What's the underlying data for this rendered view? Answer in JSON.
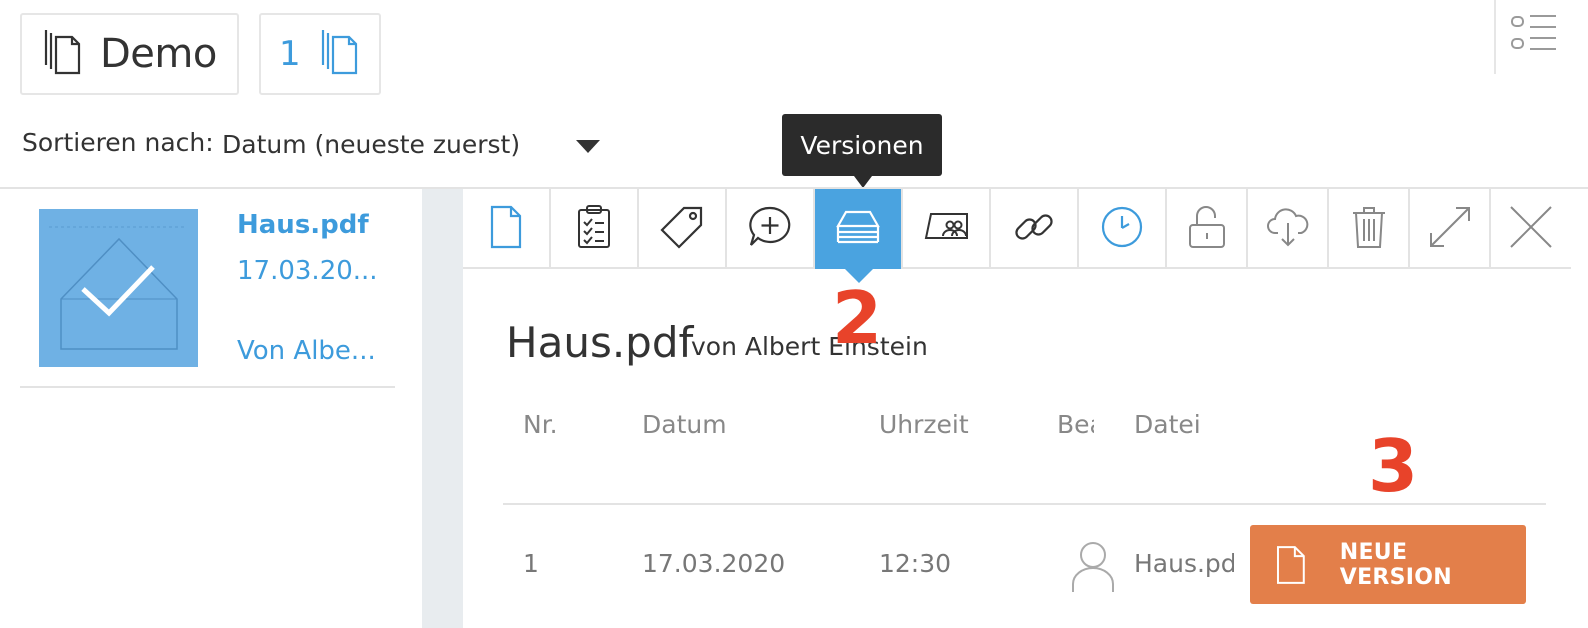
{
  "header": {
    "project_button_label": "Demo",
    "document_count_label": "1"
  },
  "sort": {
    "label": "Sortieren nach:",
    "value": "Datum (neueste zuerst)"
  },
  "tooltip": {
    "text": "Versionen"
  },
  "file_list": {
    "items": [
      {
        "name": "Haus.pdf",
        "date": "17.03.20...",
        "author": "Von Albe..."
      }
    ]
  },
  "toolbar": {
    "icons": [
      "document-icon",
      "checklist-icon",
      "tag-icon",
      "add-comment-icon",
      "versions-icon",
      "shared-users-icon",
      "link-icon",
      "clock-icon",
      "unlock-icon",
      "cloud-download-icon",
      "trash-icon",
      "expand-icon",
      "close-icon"
    ],
    "active": "versions-icon"
  },
  "annotations": {
    "marker_2": "2",
    "marker_3": "3",
    "color": "#e8432a"
  },
  "detail": {
    "title": "Haus.pdf",
    "by": "von Albert Einstein",
    "columns": {
      "nr": "Nr.",
      "datum": "Datum",
      "uhrzeit": "Uhrzeit",
      "bearbeiter": "Bearbeiter",
      "datei": "Datei"
    },
    "rows": [
      {
        "nr": "1",
        "datum": "17.03.2020",
        "uhrzeit": "12:30",
        "datei": "Haus.pdf"
      }
    ],
    "new_version_label": "NEUE VERSION"
  },
  "colors": {
    "accent_blue": "#3d9bdc",
    "active_tab": "#4aa3e0",
    "button_orange": "#e37f4a"
  }
}
